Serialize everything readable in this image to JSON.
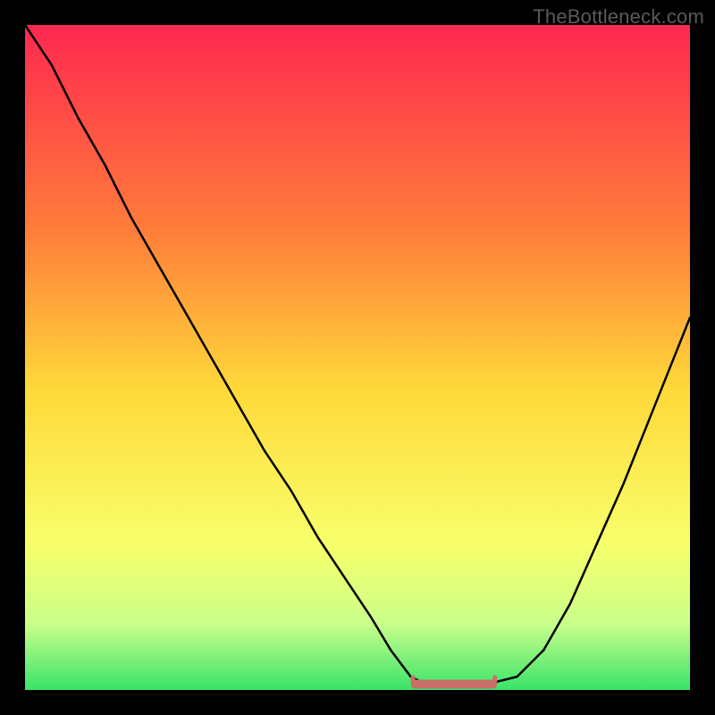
{
  "watermark": "TheBottleneck.com",
  "colors": {
    "frame": "#000000",
    "watermark": "#5a5a5a",
    "gradient_top": "#ff2850",
    "gradient_upper_mid": "#ff8a3a",
    "gradient_mid": "#ffd93a",
    "gradient_lower_mid": "#f8ff6a",
    "gradient_near_bottom": "#caff8a",
    "gradient_bottom": "#39e36a",
    "curve_stroke": "#000000",
    "flat_marker": "#cc6e6a"
  },
  "chart_data": {
    "type": "line",
    "title": "",
    "xlabel": "",
    "ylabel": "",
    "xlim": [
      0,
      100
    ],
    "ylim": [
      0,
      100
    ],
    "x": [
      0,
      4,
      8,
      12,
      16,
      20,
      24,
      28,
      32,
      36,
      40,
      44,
      48,
      52,
      55,
      58,
      60,
      62,
      66,
      70,
      74,
      78,
      82,
      86,
      90,
      94,
      98,
      100
    ],
    "series": [
      {
        "name": "bottleneck-curve",
        "values": [
          100,
          94,
          86,
          79,
          71,
          64,
          57,
          50,
          43,
          36,
          30,
          23,
          17,
          11,
          6,
          2,
          1,
          1,
          1,
          1,
          2,
          6,
          13,
          22,
          31,
          41,
          51,
          56
        ]
      }
    ],
    "annotations": [
      {
        "name": "optimal-flat-region",
        "x_range": [
          58,
          71
        ],
        "y": 1,
        "marker_color": "#cc6e6a"
      }
    ],
    "background_gradient": {
      "direction": "vertical",
      "stops": [
        {
          "pos": 0.0,
          "color": "#ff2850"
        },
        {
          "pos": 0.3,
          "color": "#ff7a3a"
        },
        {
          "pos": 0.55,
          "color": "#ffd93a"
        },
        {
          "pos": 0.78,
          "color": "#f8ff6a"
        },
        {
          "pos": 0.9,
          "color": "#caff8a"
        },
        {
          "pos": 1.0,
          "color": "#39e36a"
        }
      ]
    }
  }
}
